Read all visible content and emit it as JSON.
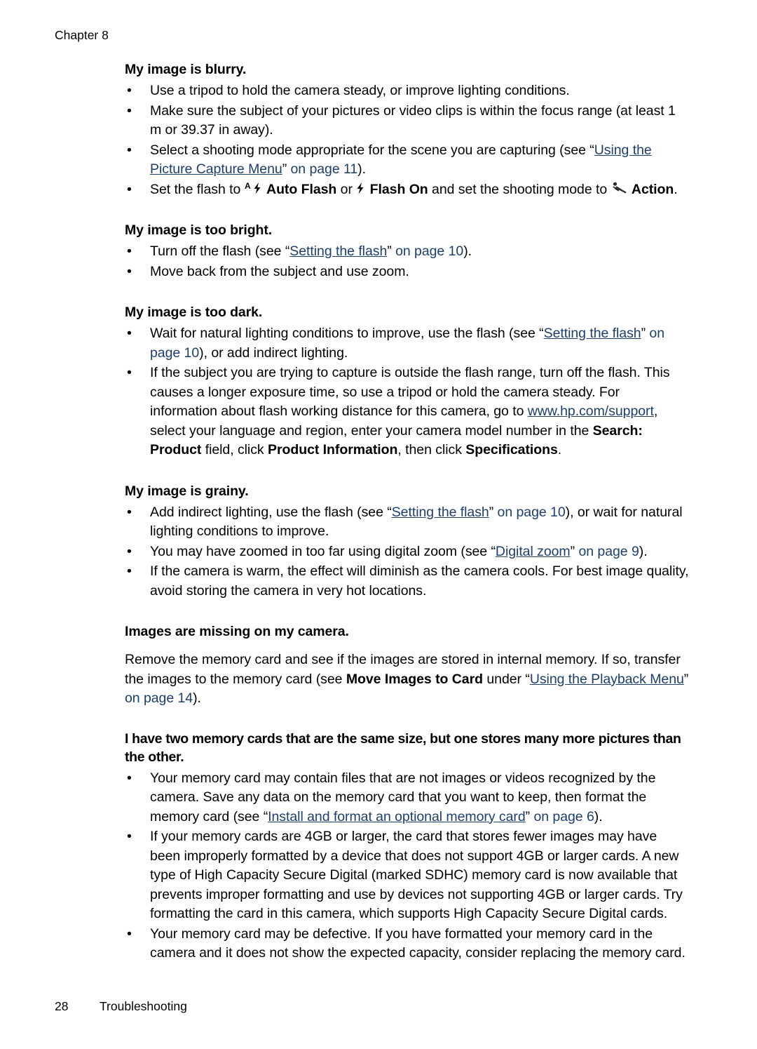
{
  "header": {
    "chapter": "Chapter 8"
  },
  "footer": {
    "page_number": "28",
    "section_name": "Troubleshooting"
  },
  "icons": {
    "auto_flash": "auto-flash-icon",
    "flash_on": "flash-on-icon",
    "action_mode": "action-running-person-icon"
  },
  "colors": {
    "link": "#1c3f6e",
    "text": "#000000",
    "background": "#ffffff"
  },
  "sections": [
    {
      "id": "blurry",
      "heading": "My image is blurry.",
      "bullets": [
        {
          "parts": [
            {
              "t": "Use a tripod to hold the camera steady, or improve lighting conditions.",
              "s": "plain"
            }
          ]
        },
        {
          "parts": [
            {
              "t": "Make sure the subject of your pictures or video clips is within the focus range (at least 1 m or 39.37 in away).",
              "s": "plain"
            }
          ]
        },
        {
          "parts": [
            {
              "t": "Select a shooting mode appropriate for the scene you are capturing (see “",
              "s": "plain"
            },
            {
              "t": "Using the Picture Capture Menu",
              "s": "link"
            },
            {
              "t": "” ",
              "s": "plain"
            },
            {
              "t": "on page 11",
              "s": "linkplain"
            },
            {
              "t": ").",
              "s": "plain"
            }
          ]
        },
        {
          "parts": [
            {
              "t": "Set the flash to ",
              "s": "plain"
            },
            {
              "t": "",
              "s": "icon-auto-flash"
            },
            {
              "t": "Auto Flash",
              "s": "bold"
            },
            {
              "t": " or ",
              "s": "plain"
            },
            {
              "t": "",
              "s": "icon-flash-on"
            },
            {
              "t": "Flash On",
              "s": "bold"
            },
            {
              "t": " and set the shooting mode to ",
              "s": "plain"
            },
            {
              "t": "",
              "s": "icon-action"
            },
            {
              "t": "Action",
              "s": "bold"
            },
            {
              "t": ".",
              "s": "plain"
            }
          ]
        }
      ]
    },
    {
      "id": "too-bright",
      "heading": "My image is too bright.",
      "bullets": [
        {
          "parts": [
            {
              "t": "Turn off the flash (see “",
              "s": "plain"
            },
            {
              "t": "Setting the flash",
              "s": "link"
            },
            {
              "t": "” ",
              "s": "plain"
            },
            {
              "t": "on page 10",
              "s": "linkplain"
            },
            {
              "t": ").",
              "s": "plain"
            }
          ]
        },
        {
          "parts": [
            {
              "t": "Move back from the subject and use zoom.",
              "s": "plain"
            }
          ]
        }
      ]
    },
    {
      "id": "too-dark",
      "heading": "My image is too dark.",
      "bullets": [
        {
          "parts": [
            {
              "t": "Wait for natural lighting conditions to improve, use the flash (see “",
              "s": "plain"
            },
            {
              "t": "Setting the flash",
              "s": "link"
            },
            {
              "t": "” ",
              "s": "plain"
            },
            {
              "t": "on page 10",
              "s": "linkplain"
            },
            {
              "t": "), or add indirect lighting.",
              "s": "plain"
            }
          ]
        },
        {
          "parts": [
            {
              "t": "If the subject you are trying to capture is outside the flash range, turn off the flash. This causes a longer exposure time, so use a tripod or hold the camera steady. For information about flash working distance for this camera, go to ",
              "s": "plain"
            },
            {
              "t": "www.hp.com/support",
              "s": "link"
            },
            {
              "t": ", select your language and region, enter your camera model number in the ",
              "s": "plain"
            },
            {
              "t": "Search: Product",
              "s": "bold"
            },
            {
              "t": " field, click ",
              "s": "plain"
            },
            {
              "t": "Product Information",
              "s": "bold"
            },
            {
              "t": ", then click ",
              "s": "plain"
            },
            {
              "t": "Specifications",
              "s": "bold"
            },
            {
              "t": ".",
              "s": "plain"
            }
          ]
        }
      ]
    },
    {
      "id": "grainy",
      "heading": "My image is grainy.",
      "bullets": [
        {
          "parts": [
            {
              "t": "Add indirect lighting, use the flash (see “",
              "s": "plain"
            },
            {
              "t": "Setting the flash",
              "s": "link"
            },
            {
              "t": "” ",
              "s": "plain"
            },
            {
              "t": "on page 10",
              "s": "linkplain"
            },
            {
              "t": "), or wait for natural lighting conditions to improve.",
              "s": "plain"
            }
          ]
        },
        {
          "parts": [
            {
              "t": "You may have zoomed in too far using digital zoom (see “",
              "s": "plain"
            },
            {
              "t": "Digital zoom",
              "s": "link"
            },
            {
              "t": "” ",
              "s": "plain"
            },
            {
              "t": "on page 9",
              "s": "linkplain"
            },
            {
              "t": ").",
              "s": "plain"
            }
          ]
        },
        {
          "parts": [
            {
              "t": "If the camera is warm, the effect will diminish as the camera cools. For best image quality, avoid storing the camera in very hot locations.",
              "s": "plain"
            }
          ]
        }
      ]
    },
    {
      "id": "images-missing",
      "heading": "Images are missing on my camera.",
      "paragraph": {
        "parts": [
          {
            "t": "Remove the memory card and see if the images are stored in internal memory. If so, transfer the images to the memory card (see ",
            "s": "plain"
          },
          {
            "t": "Move Images to Card",
            "s": "bold"
          },
          {
            "t": " under “",
            "s": "plain"
          },
          {
            "t": "Using the Playback Menu",
            "s": "link"
          },
          {
            "t": "” ",
            "s": "plain"
          },
          {
            "t": "on page 14",
            "s": "linkplain"
          },
          {
            "t": ").",
            "s": "plain"
          }
        ]
      }
    },
    {
      "id": "two-memory-cards",
      "heading": "I have two memory cards that are the same size, but one stores many more pictures than the other.",
      "bullets": [
        {
          "parts": [
            {
              "t": "Your memory card may contain files that are not images or videos recognized by the camera. Save any data on the memory card that you want to keep, then format the memory card (see “",
              "s": "plain"
            },
            {
              "t": "Install and format an optional memory card",
              "s": "link"
            },
            {
              "t": "” ",
              "s": "plain"
            },
            {
              "t": "on page 6",
              "s": "linkplain"
            },
            {
              "t": ").",
              "s": "plain"
            }
          ]
        },
        {
          "parts": [
            {
              "t": "If your memory cards are 4GB or larger, the card that stores fewer images may have been improperly formatted by a device that does not support 4GB or larger cards. A new type of High Capacity Secure Digital (marked SDHC) memory card is now available that prevents improper formatting and use by devices not supporting 4GB or larger cards. Try formatting the card in this camera, which supports High Capacity Secure Digital cards.",
              "s": "plain"
            }
          ]
        },
        {
          "parts": [
            {
              "t": "Your memory card may be defective. If you have formatted your memory card in the camera and it does not show the expected capacity, consider replacing the memory card.",
              "s": "plain"
            }
          ]
        }
      ]
    }
  ],
  "bullet_glyph": "•"
}
